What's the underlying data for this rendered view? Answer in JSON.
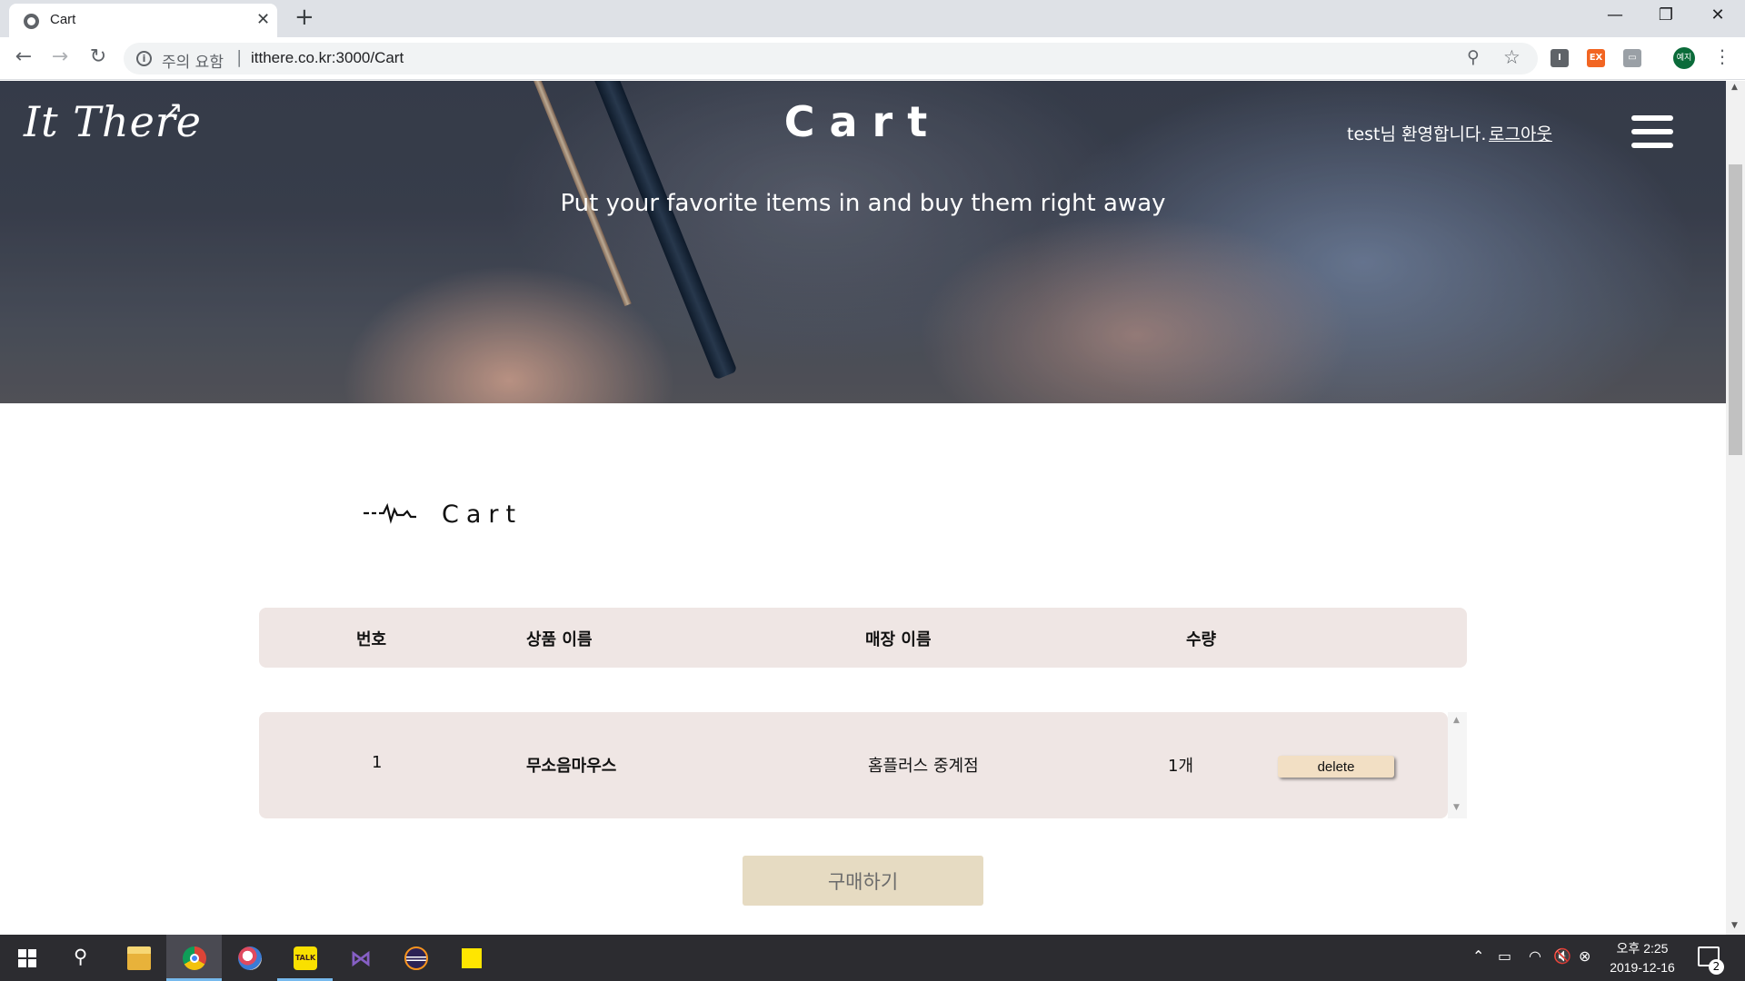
{
  "browser": {
    "tab_title": "Cart",
    "security_label": "주의 요함",
    "url": "itthere.co.kr:3000/Cart"
  },
  "hero": {
    "logo": "It There",
    "title": "Cart",
    "subtitle": "Put your favorite items in and buy them right away",
    "welcome_text": "test님 환영합니다.",
    "logout_label": "로그아웃"
  },
  "section": {
    "title": "Cart"
  },
  "table": {
    "headers": [
      "번호",
      "상품 이름",
      "매장 이름",
      "수량"
    ],
    "rows": [
      {
        "no": "1",
        "product": "무소음마우스",
        "store": "홈플러스 중계점",
        "qty": "1개",
        "action_label": "delete"
      }
    ]
  },
  "purchase_label": "구매하기",
  "taskbar": {
    "clock_period_time": "오후 2:25",
    "clock_date": "2019-12-16",
    "notification_count": "2",
    "colors": {
      "accent": "#76b9ed"
    }
  },
  "colors": {
    "table_bg": "#efe6e4",
    "delete_button": "#f2dfc4",
    "purchase_button": "#e6dbc2"
  }
}
